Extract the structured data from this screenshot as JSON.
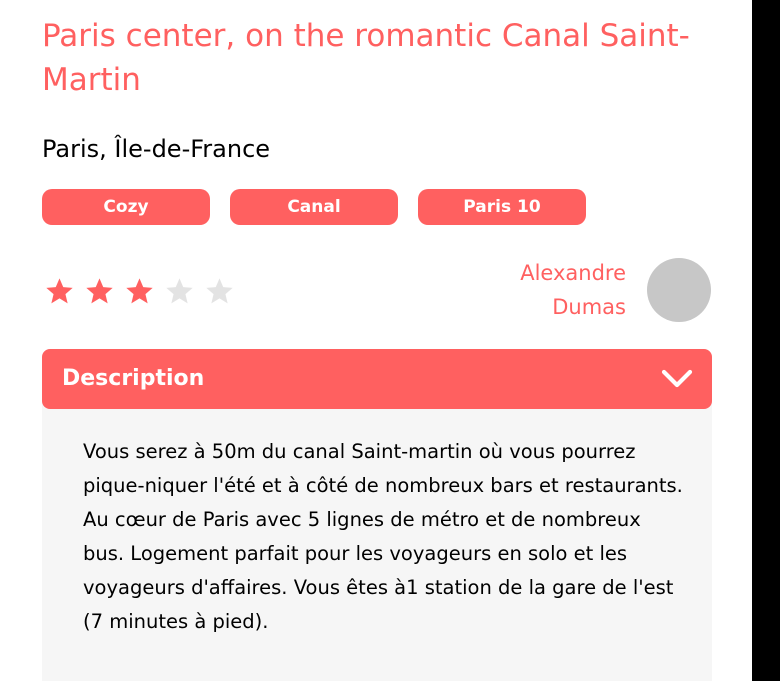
{
  "listing": {
    "title": "Paris center, on the romantic Canal Saint-Martin",
    "location": "Paris, Île-de-France",
    "tags": [
      "Cozy",
      "Canal",
      "Paris 10"
    ],
    "rating": 3,
    "rating_max": 5
  },
  "host": {
    "first_name": "Alexandre",
    "last_name": "Dumas"
  },
  "description": {
    "title": "Description",
    "text": "Vous serez à 50m du canal Saint-martin où vous pourrez pique-niquer l'été et à côté de nombreux bars et restaurants. Au cœur de Paris avec 5 lignes de métro et de nombreux bus. Logement parfait pour les voyageurs en solo et les voyageurs d'affaires. Vous êtes à1 station de la gare de l'est (7 minutes à pied)."
  },
  "colors": {
    "accent": "#ff6060",
    "star_off": "#e3e3e3",
    "avatar_placeholder": "#c7c7c7",
    "panel_bg": "#f6f6f6"
  },
  "icons": {
    "star": "star-icon",
    "collapse": "chevron-down-icon"
  }
}
